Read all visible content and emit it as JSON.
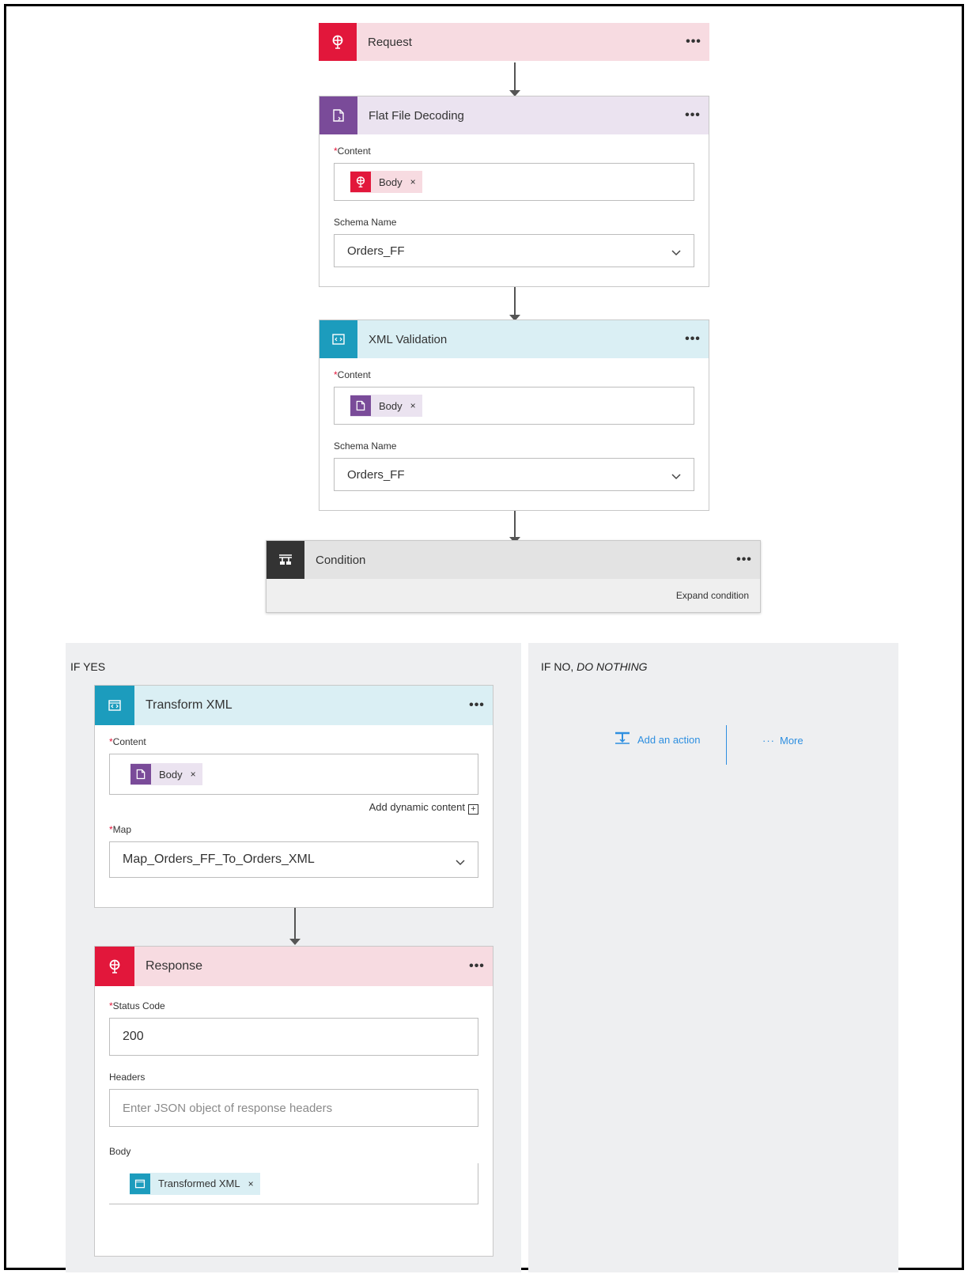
{
  "request": {
    "title": "Request",
    "menu": "•••"
  },
  "flat_file": {
    "title": "Flat File Decoding",
    "menu": "•••",
    "content_label": "Content",
    "content_token": "Body",
    "token_remove": "×",
    "schema_label": "Schema Name",
    "schema_value": "Orders_FF"
  },
  "xml_validation": {
    "title": "XML Validation",
    "menu": "•••",
    "content_label": "Content",
    "content_token": "Body",
    "token_remove": "×",
    "schema_label": "Schema Name",
    "schema_value": "Orders_FF"
  },
  "condition": {
    "title": "Condition",
    "menu": "•••",
    "expand_label": "Expand condition"
  },
  "if_yes": {
    "title": "IF YES"
  },
  "if_no": {
    "title_prefix": "IF NO, ",
    "title_emphasis": "DO NOTHING",
    "add_action": "Add an action",
    "more": "More"
  },
  "transform": {
    "title": "Transform XML",
    "menu": "•••",
    "content_label": "Content",
    "content_token": "Body",
    "token_remove": "×",
    "dynamic_content": "Add dynamic content",
    "dynamic_icon": "+",
    "map_label": "Map",
    "map_value": "Map_Orders_FF_To_Orders_XML"
  },
  "response": {
    "title": "Response",
    "menu": "•••",
    "status_label": "Status Code",
    "status_value": "200",
    "headers_label": "Headers",
    "headers_placeholder": "Enter JSON object of response headers",
    "body_label": "Body",
    "body_token": "Transformed XML",
    "token_remove": "×"
  },
  "required_marker": "*",
  "colors": {
    "request_accent": "#e2173b",
    "flatfile_accent": "#7a4b99",
    "xml_accent": "#1c9cbd",
    "condition_accent": "#333333",
    "link_blue": "#2e8fe0"
  },
  "icons": {
    "request": "globe-icon",
    "flat_file": "flat-file-icon",
    "xml": "xml-doc-icon",
    "condition": "condition-icon",
    "add_action": "add-action-icon",
    "more": "ellipsis-icon",
    "chevron": "chevron-down-icon"
  }
}
